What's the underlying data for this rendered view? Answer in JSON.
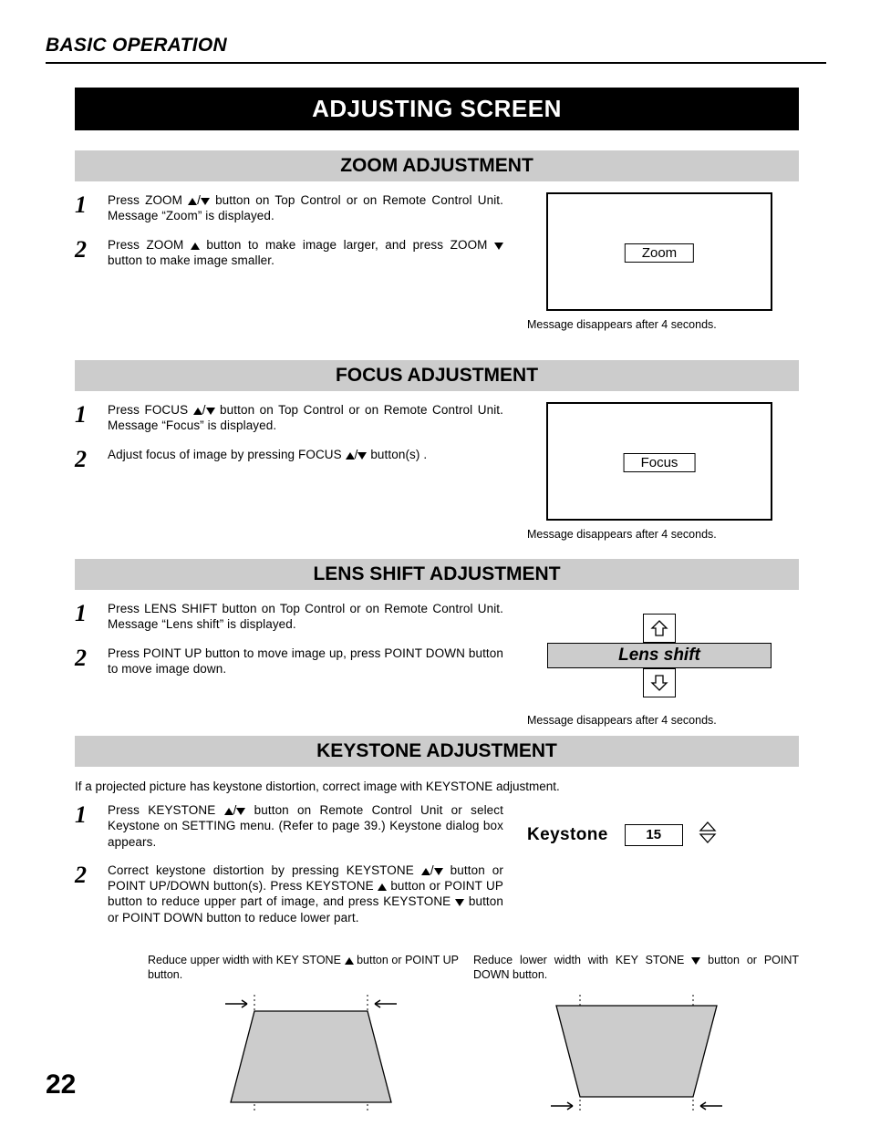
{
  "header": {
    "heading": "BASIC OPERATION"
  },
  "title": "ADJUSTING SCREEN",
  "zoom": {
    "heading": "ZOOM ADJUSTMENT",
    "step1_a": "Press ZOOM ",
    "step1_b": " button on Top Control or on Remote Control Unit. Message “Zoom” is displayed.",
    "step2_a": "Press ZOOM ",
    "step2_b": " button to make image larger, and press ZOOM ",
    "step2_c": " button to make image smaller.",
    "label": "Zoom",
    "caption": "Message disappears after 4 seconds."
  },
  "focus": {
    "heading": "FOCUS ADJUSTMENT",
    "step1_a": "Press FOCUS ",
    "step1_b": " button on Top Control or on Remote Control Unit. Message “Focus” is displayed.",
    "step2_a": "Adjust focus of image by pressing FOCUS ",
    "step2_b": "  button(s) .",
    "label": "Focus",
    "caption": "Message disappears after 4 seconds."
  },
  "lens": {
    "heading": "LENS SHIFT ADJUSTMENT",
    "step1": "Press LENS SHIFT button on Top Control or on Remote Control Unit. Message “Lens shift” is displayed.",
    "step2": "Press POINT UP button to move image up, press POINT DOWN button to move image down.",
    "label": "Lens shift",
    "caption": "Message disappears after 4 seconds."
  },
  "keystone": {
    "heading": "KEYSTONE ADJUSTMENT",
    "intro": "If a projected picture has keystone distortion, correct image with KEYSTONE adjustment.",
    "step1_a": "Press KEYSTONE ",
    "step1_b": " button on Remote Control Unit or select Keystone on SETTING menu.  (Refer to page 39.)  Keystone dialog box appears.",
    "step2_a": "Correct keystone distortion by pressing KEYSTONE ",
    "step2_b": " button or POINT UP/DOWN button(s).  Press KEYSTONE ",
    "step2_c": " button or POINT UP button to reduce upper part of image, and press KEYSTONE ",
    "step2_d": " button or POINT DOWN button to reduce lower part.",
    "ui_label": "Keystone",
    "ui_value": "15",
    "col1_a": "Reduce upper width with KEY STONE ",
    "col1_b": " button or POINT UP button.",
    "col2_a": "Reduce lower width with KEY STONE ",
    "col2_b": " button or POINT DOWN button."
  },
  "page_number": "22"
}
